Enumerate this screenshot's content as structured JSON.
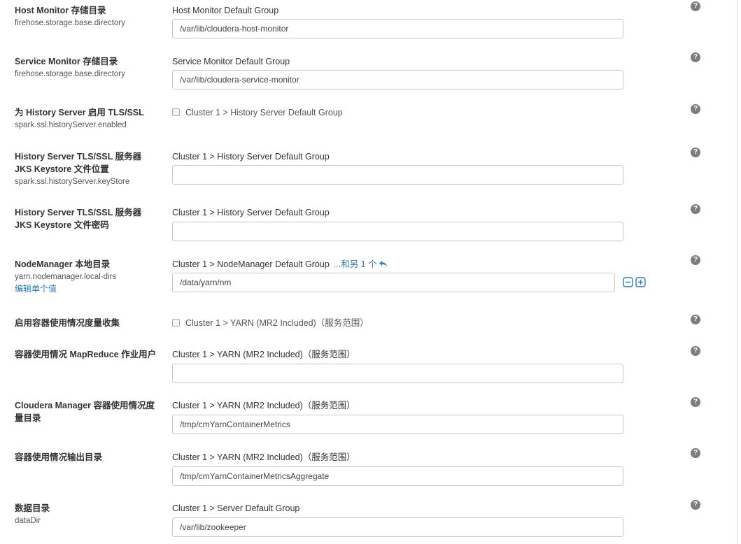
{
  "help_glyph": "?",
  "rows": [
    {
      "label": "Host Monitor 存储目录",
      "property": "firehose.storage.base.directory",
      "group": "Host Monitor Default Group",
      "value": "/var/lib/cloudera-host-monitor"
    },
    {
      "label": "Service Monitor 存储目录",
      "property": "firehose.storage.base.directory",
      "group": "Service Monitor Default Group",
      "value": "/var/lib/cloudera-service-monitor"
    },
    {
      "label": "为 History Server 启用 TLS/SSL",
      "property": "spark.ssl.historyServer.enabled",
      "checkbox_label": "Cluster 1 > History Server Default Group",
      "checked": false
    },
    {
      "label": "History Server TLS/SSL 服务器 JKS Keystore 文件位置",
      "property": "spark.ssl.historyServer.keyStore",
      "group": "Cluster 1 > History Server Default Group",
      "value": ""
    },
    {
      "label": "History Server TLS/SSL 服务器 JKS Keystore 文件密码",
      "group": "Cluster 1 > History Server Default Group",
      "value": ""
    },
    {
      "label": "NodeManager 本地目录",
      "property": "yarn.nodemanager.local-dirs",
      "edit_link": "编辑单个值",
      "group": "Cluster 1 > NodeManager Default Group",
      "more": "...和另 1 个",
      "value": "/data/yarn/nm"
    },
    {
      "label": "启用容器使用情况度量收集",
      "checkbox_label": "Cluster 1 > YARN (MR2 Included)（服务范围）",
      "checked": false
    },
    {
      "label": "容器使用情况 MapReduce 作业用户",
      "group": "Cluster 1 > YARN (MR2 Included)（服务范围）",
      "value": ""
    },
    {
      "label": "Cloudera Manager 容器使用情况度量目录",
      "group": "Cluster 1 > YARN (MR2 Included)（服务范围）",
      "value": "/tmp/cmYarnContainerMetrics"
    },
    {
      "label": "容器使用情况输出目录",
      "group": "Cluster 1 > YARN (MR2 Included)（服务范围）",
      "value": "/tmp/cmYarnContainerMetricsAggregate"
    },
    {
      "label": "数据目录",
      "property": "dataDir",
      "group": "Cluster 1 > Server Default Group",
      "value": "/var/lib/zookeeper"
    }
  ],
  "colors": {
    "link": "#2a7bbd",
    "help_icon": "#7d7d7d",
    "input_border": "#c8c8c8"
  },
  "icons": {
    "undo": "undo-arrow-icon",
    "remove": "minus-square-icon",
    "add": "plus-square-icon",
    "help": "question-circle-icon"
  }
}
